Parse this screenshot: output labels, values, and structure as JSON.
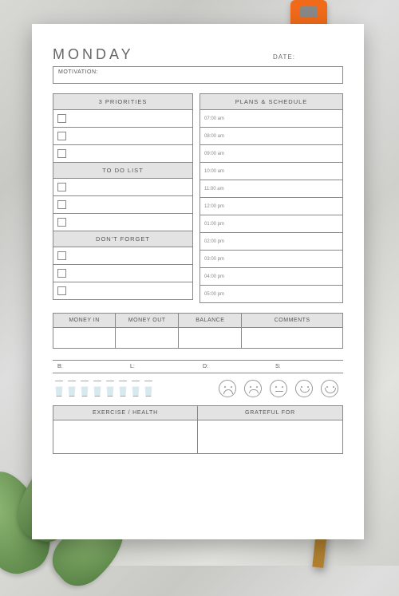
{
  "header": {
    "day": "MONDAY",
    "date_label": "DATE:"
  },
  "motivation_label": "MOTIVATION:",
  "left": {
    "priorities": {
      "title": "3 PRIORITIES",
      "rows": 3
    },
    "todo": {
      "title": "TO DO LIST",
      "rows": 3
    },
    "dont_forget": {
      "title": "DON'T FORGET",
      "rows": 3
    }
  },
  "schedule": {
    "title": "PLANS & SCHEDULE",
    "times": [
      "07:00 am",
      "08:00 am",
      "09:00 am",
      "10:00 am",
      "11:00 am",
      "12:00 pm",
      "01:00 pm",
      "02:00 pm",
      "03:00 pm",
      "04:00 pm",
      "05:00 pm"
    ]
  },
  "money": {
    "in": "MONEY IN",
    "out": "MONEY OUT",
    "balance": "BALANCE",
    "comments": "COMMENTS"
  },
  "meals": {
    "b": "B:",
    "l": "L:",
    "d": "D:",
    "s": "S:"
  },
  "water_glasses": 8,
  "moods": [
    "sad",
    "frown",
    "neutral",
    "smile",
    "happy"
  ],
  "footer": {
    "exercise": "EXERCISE / HEALTH",
    "grateful": "GRATEFUL FOR"
  }
}
